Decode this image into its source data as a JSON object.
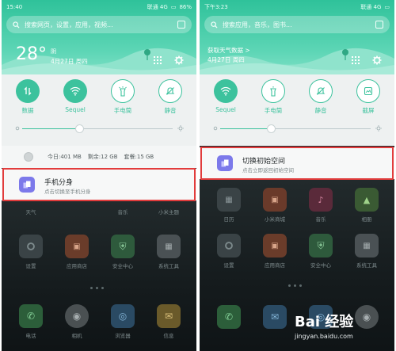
{
  "left": {
    "status": {
      "time": "15:40",
      "carrier": "联通 4G",
      "battery": "86%"
    },
    "search": {
      "placeholder": "搜索网页，设置，应用，视频..."
    },
    "weather": {
      "temp": "28°",
      "condition": "阴",
      "date": "4月27日 周四"
    },
    "toggles": [
      {
        "label": "数据",
        "state": "on",
        "icon": "data-arrows-icon"
      },
      {
        "label": "Sequel",
        "state": "on",
        "icon": "wifi-icon"
      },
      {
        "label": "手电筒",
        "state": "off",
        "icon": "flashlight-icon"
      },
      {
        "label": "静音",
        "state": "off",
        "icon": "mute-bell-icon"
      }
    ],
    "brightness": 0.38,
    "storage": {
      "today": "今日:401 MB",
      "remaining": "剩余:12 GB",
      "total": "套餐:15 GB"
    },
    "card": {
      "title": "手机分身",
      "subtitle": "点击切换至手机分身"
    },
    "home_row1_labels": [
      "天气",
      "",
      "音乐",
      "小米主题"
    ],
    "home_row2_labels": [
      "设置",
      "应用商店",
      "安全中心",
      "系统工具"
    ],
    "dock_labels": [
      "电话",
      "相机",
      "浏览器",
      "信息"
    ]
  },
  "right": {
    "status": {
      "time": "下午3:23",
      "carrier": "联通 4G"
    },
    "search": {
      "placeholder": "搜索应用，音乐，图书..."
    },
    "weather": {
      "line1": "获取天气数据 >",
      "date": "4月27日 周四"
    },
    "toggles": [
      {
        "label": "Sequel",
        "state": "on",
        "icon": "wifi-icon"
      },
      {
        "label": "手电筒",
        "state": "off",
        "icon": "flashlight-icon"
      },
      {
        "label": "静音",
        "state": "off",
        "icon": "mute-bell-icon"
      },
      {
        "label": "截屏",
        "state": "off",
        "icon": "screenshot-icon"
      }
    ],
    "brightness": 0.34,
    "card": {
      "title": "切换初始空间",
      "subtitle": "点击立即返回初始空间"
    },
    "home_row1_labels": [
      "日历",
      "小米商城",
      "音乐",
      "相册"
    ],
    "home_row2_labels": [
      "设置",
      "应用商店",
      "安全中心",
      "系统工具"
    ]
  },
  "watermark": {
    "brand": "Bai 经验",
    "url": "jingyan.baidu.com"
  },
  "colors": {
    "accent": "#3cc29d",
    "highlight": "#e23c3c",
    "app_icon": "#7c79ea"
  }
}
